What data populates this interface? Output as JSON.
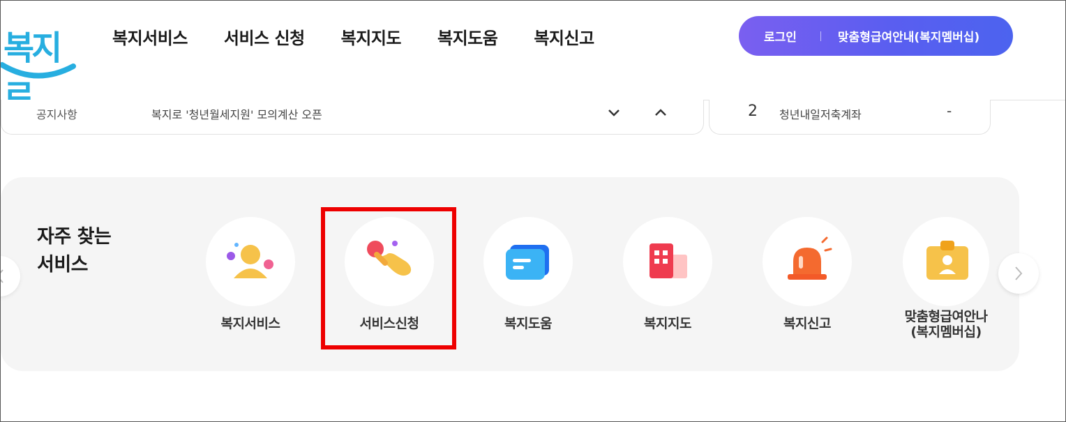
{
  "header": {
    "logo_text": "복지로",
    "nav": [
      "복지서비스",
      "서비스 신청",
      "복지지도",
      "복지도움",
      "복지신고"
    ],
    "login": "로그인",
    "membership": "맞춤형급여안내(복지멤버십)"
  },
  "notice": {
    "label": "공지사항",
    "text": "복지로 '청년월세지원' 모의계산 오픈"
  },
  "ranking": {
    "number": "2",
    "text": "청년내일저축계좌",
    "change": "-"
  },
  "frequent": {
    "title_line1": "자주 찾는",
    "title_line2": "서비스",
    "items": [
      {
        "label": "복지서비스",
        "icon": "person-bubbles-icon"
      },
      {
        "label": "서비스신청",
        "icon": "hand-pointer-icon"
      },
      {
        "label": "복지도움",
        "icon": "chat-card-icon"
      },
      {
        "label": "복지지도",
        "icon": "building-map-icon"
      },
      {
        "label": "복지신고",
        "icon": "siren-icon"
      },
      {
        "label_line1": "맞춤형급여안나",
        "label_line2": "(복지멤버십)",
        "icon": "id-badge-icon"
      }
    ]
  },
  "colors": {
    "accent_gradient_start": "#7a5ff0",
    "accent_gradient_end": "#4c63ef",
    "logo": "#27aee0",
    "highlight": "#ee0000",
    "section_bg": "#f5f5f5"
  }
}
